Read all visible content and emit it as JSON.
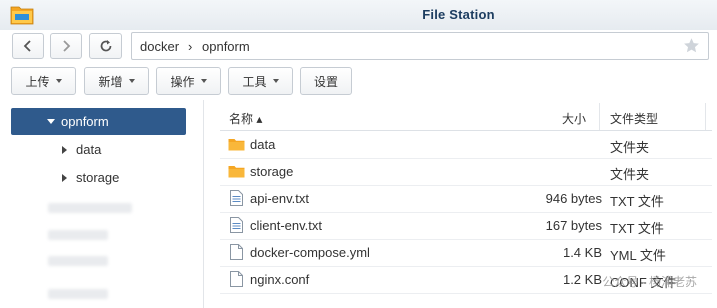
{
  "window": {
    "title": "File Station"
  },
  "path": {
    "segments": [
      "docker",
      "opnform"
    ],
    "separator": "›"
  },
  "toolbar": {
    "upload": "上传",
    "new": "新增",
    "action": "操作",
    "tools": "工具",
    "settings": "设置"
  },
  "sidebar": {
    "selected": "opnform",
    "children": [
      "data",
      "storage"
    ]
  },
  "table": {
    "headers": {
      "name": "名称 ▴",
      "size": "大小",
      "type": "文件类型"
    },
    "rows": [
      {
        "name": "data",
        "size": "",
        "type": "文件夹",
        "icon": "folder-icon"
      },
      {
        "name": "storage",
        "size": "",
        "type": "文件夹",
        "icon": "folder-icon"
      },
      {
        "name": "api-env.txt",
        "size": "946 bytes",
        "type": "TXT 文件",
        "icon": "text-file-icon"
      },
      {
        "name": "client-env.txt",
        "size": "167 bytes",
        "type": "TXT 文件",
        "icon": "text-file-icon"
      },
      {
        "name": "docker-compose.yml",
        "size": "1.4 KB",
        "type": "YML 文件",
        "icon": "file-icon"
      },
      {
        "name": "nginx.conf",
        "size": "1.2 KB",
        "type": "CONF 文件",
        "icon": "file-icon"
      }
    ]
  },
  "watermark": "公众号 · 杨浦老苏",
  "colors": {
    "accent": "#2f5a8c",
    "folder": "#f5a623",
    "title": "#1d3d60"
  }
}
